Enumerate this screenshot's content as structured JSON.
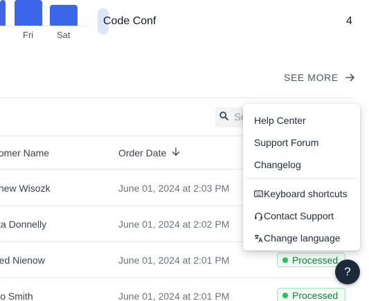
{
  "chart_data": {
    "type": "bar",
    "categories": [
      "Fri",
      "Sat"
    ],
    "values": [
      null,
      null
    ]
  },
  "chart": {
    "bar_color": "#3b66ea"
  },
  "top_conference": {
    "name": "Code Conf",
    "count": "4"
  },
  "see_more": {
    "label": "SEE MORE",
    "icon": "arrow-right-icon"
  },
  "search": {
    "placeholder": "Search",
    "icon": "search-icon"
  },
  "table": {
    "headers": {
      "customer_name": "tomer Name",
      "order_date": "Order Date",
      "order_date_sort_icon": "arrow-down-icon"
    },
    "rows": [
      {
        "customer": "thew Wisozk",
        "date": "June 01, 2024 at 2:03 PM",
        "status": ""
      },
      {
        "customer": "ita Donnelly",
        "date": "June 01, 2024 at 2:02 PM",
        "status": ""
      },
      {
        "customer": "red Nienow",
        "date": "June 01, 2024 at 2:01 PM",
        "status": "Processed"
      },
      {
        "customer": "lio Smith",
        "date": "June 01, 2024 at 2:01 PM",
        "status": "Processed"
      }
    ],
    "status_color": "#16803c"
  },
  "help_menu": {
    "items": [
      {
        "label": "Help Center"
      },
      {
        "label": "Support Forum"
      },
      {
        "label": "Changelog"
      }
    ],
    "items_with_icons": [
      {
        "label": "Keyboard shortcuts",
        "icon": "keyboard-icon"
      },
      {
        "label": "Contact Support",
        "icon": "headset-icon"
      },
      {
        "label": "Change language",
        "icon": "translate-icon"
      }
    ]
  },
  "help_button": {
    "label": "?",
    "color": "#1e2a3b"
  }
}
